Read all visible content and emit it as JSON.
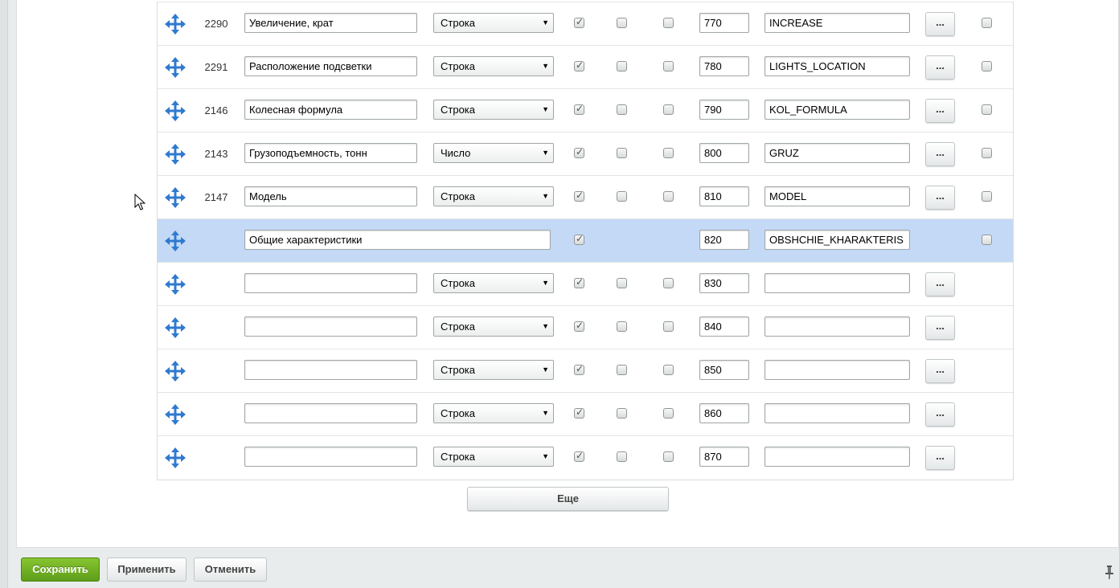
{
  "rows": [
    {
      "id": "2290",
      "name": "Увеличение, крат",
      "type": "Строка",
      "c1": true,
      "c2": false,
      "c3": false,
      "sort": "770",
      "code": "INCREASE",
      "more": "...",
      "del": false
    },
    {
      "id": "2291",
      "name": "Расположение подсветки",
      "type": "Строка",
      "c1": true,
      "c2": false,
      "c3": false,
      "sort": "780",
      "code": "LIGHTS_LOCATION",
      "more": "...",
      "del": false
    },
    {
      "id": "2146",
      "name": "Колесная формула",
      "type": "Строка",
      "c1": true,
      "c2": false,
      "c3": false,
      "sort": "790",
      "code": "KOL_FORMULA",
      "more": "...",
      "del": false
    },
    {
      "id": "2143",
      "name": "Грузоподъемность, тонн",
      "type": "Число",
      "c1": true,
      "c2": false,
      "c3": false,
      "sort": "800",
      "code": "GRUZ",
      "more": "...",
      "del": false
    },
    {
      "id": "2147",
      "name": "Модель",
      "type": "Строка",
      "c1": true,
      "c2": false,
      "c3": false,
      "sort": "810",
      "code": "MODEL",
      "more": "...",
      "del": false
    },
    {
      "id": "",
      "name": "Общие характеристики",
      "section": true,
      "c1": true,
      "sort": "820",
      "code": "OBSHCHIE_KHARAKTERIS",
      "del": false
    },
    {
      "id": "",
      "name": "",
      "type": "Строка",
      "c1": true,
      "c2": false,
      "c3": false,
      "sort": "830",
      "code": "",
      "more": "..."
    },
    {
      "id": "",
      "name": "",
      "type": "Строка",
      "c1": true,
      "c2": false,
      "c3": false,
      "sort": "840",
      "code": "",
      "more": "..."
    },
    {
      "id": "",
      "name": "",
      "type": "Строка",
      "c1": true,
      "c2": false,
      "c3": false,
      "sort": "850",
      "code": "",
      "more": "..."
    },
    {
      "id": "",
      "name": "",
      "type": "Строка",
      "c1": true,
      "c2": false,
      "c3": false,
      "sort": "860",
      "code": "",
      "more": "..."
    },
    {
      "id": "",
      "name": "",
      "type": "Строка",
      "c1": true,
      "c2": false,
      "c3": false,
      "sort": "870",
      "code": "",
      "more": "..."
    }
  ],
  "more_button": "Еще",
  "footer": {
    "save": "Сохранить",
    "apply": "Применить",
    "cancel": "Отменить"
  },
  "icons": {
    "drag": "move-arrows-icon",
    "pin": "pin-icon"
  },
  "colors": {
    "highlight_row": "#c3d9f6",
    "save_button": "#6aab22",
    "drag_icon": "#2f7ad0"
  }
}
